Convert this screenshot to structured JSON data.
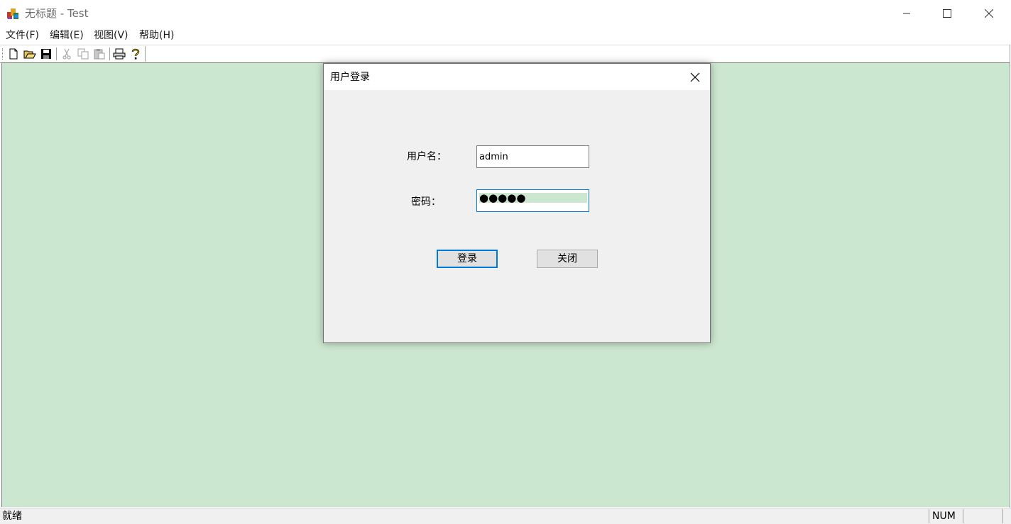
{
  "window": {
    "title": "无标题 - Test",
    "minimize_icon": "minimize-icon",
    "maximize_icon": "maximize-icon",
    "close_icon": "close-icon"
  },
  "menu": {
    "items": [
      {
        "label": "文件(F)"
      },
      {
        "label": "编辑(E)"
      },
      {
        "label": "视图(V)"
      },
      {
        "label": "帮助(H)"
      }
    ]
  },
  "toolbar": {
    "buttons": [
      {
        "icon": "new-file-icon"
      },
      {
        "icon": "open-folder-icon"
      },
      {
        "icon": "save-icon"
      },
      {
        "icon": "cut-icon",
        "disabled": true
      },
      {
        "icon": "copy-icon",
        "disabled": true
      },
      {
        "icon": "paste-icon",
        "disabled": true
      },
      {
        "icon": "print-icon"
      },
      {
        "icon": "help-icon"
      }
    ]
  },
  "colors": {
    "client_background": "#cce7cf",
    "accent": "#0078d7",
    "dialog_background": "#f0f0f0"
  },
  "dialog": {
    "title": "用户登录",
    "username_label": "用户名：",
    "username_value": "admin",
    "password_label": "密码：",
    "password_mask": "●●●●●",
    "login_button": "登录",
    "close_button": "关闭"
  },
  "status": {
    "text": "就绪",
    "num_indicator": "NUM"
  }
}
